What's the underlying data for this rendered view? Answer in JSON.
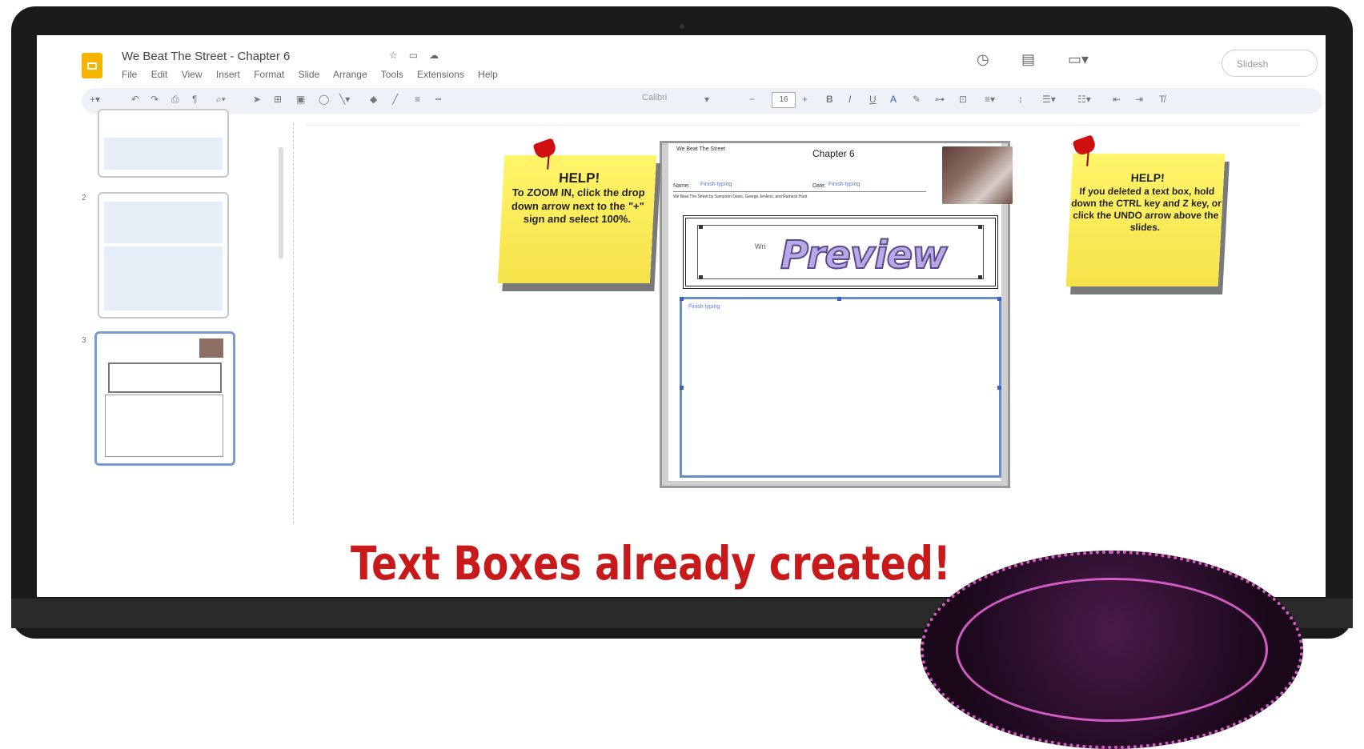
{
  "app": {
    "doc_title": "We Beat The Street - Chapter 6",
    "menu": [
      "File",
      "Edit",
      "View",
      "Insert",
      "Format",
      "Slide",
      "Arrange",
      "Tools",
      "Extensions",
      "Help"
    ],
    "slideshow_label": "Slidesh",
    "toolbar": {
      "font": "Calibri",
      "font_size": "16",
      "minus": "−",
      "plus": "+"
    }
  },
  "filmstrip": {
    "slide_numbers": [
      "2",
      "3"
    ]
  },
  "slide": {
    "header_label": "We Beat The Street",
    "heading": "Chapter 6",
    "name_label": "Name:",
    "date_label": "Date:",
    "placeholder": "Finish typing",
    "instruction_line": "We Beat The Street by Sampson Davis, George Jenkins, and Rameck Hunt",
    "preview_text": "Preview",
    "preview_side_label": "Wri",
    "big_box_placeholder": "Finish typing"
  },
  "notes": {
    "left": {
      "title": "HELP!",
      "body": "To ZOOM IN, click the drop down arrow next to the \"+\" sign and select 100%."
    },
    "right": {
      "title": "HELP!",
      "body": "If you deleted a text box, hold down the CTRL key and Z key, or click the UNDO arrow above the slides."
    }
  },
  "caption": "Text Boxes already created!",
  "colors": {
    "caption": "#c81a1a",
    "note": "#f6e24a",
    "pin": "#d01010",
    "accent_border": "#6a8cc7"
  }
}
